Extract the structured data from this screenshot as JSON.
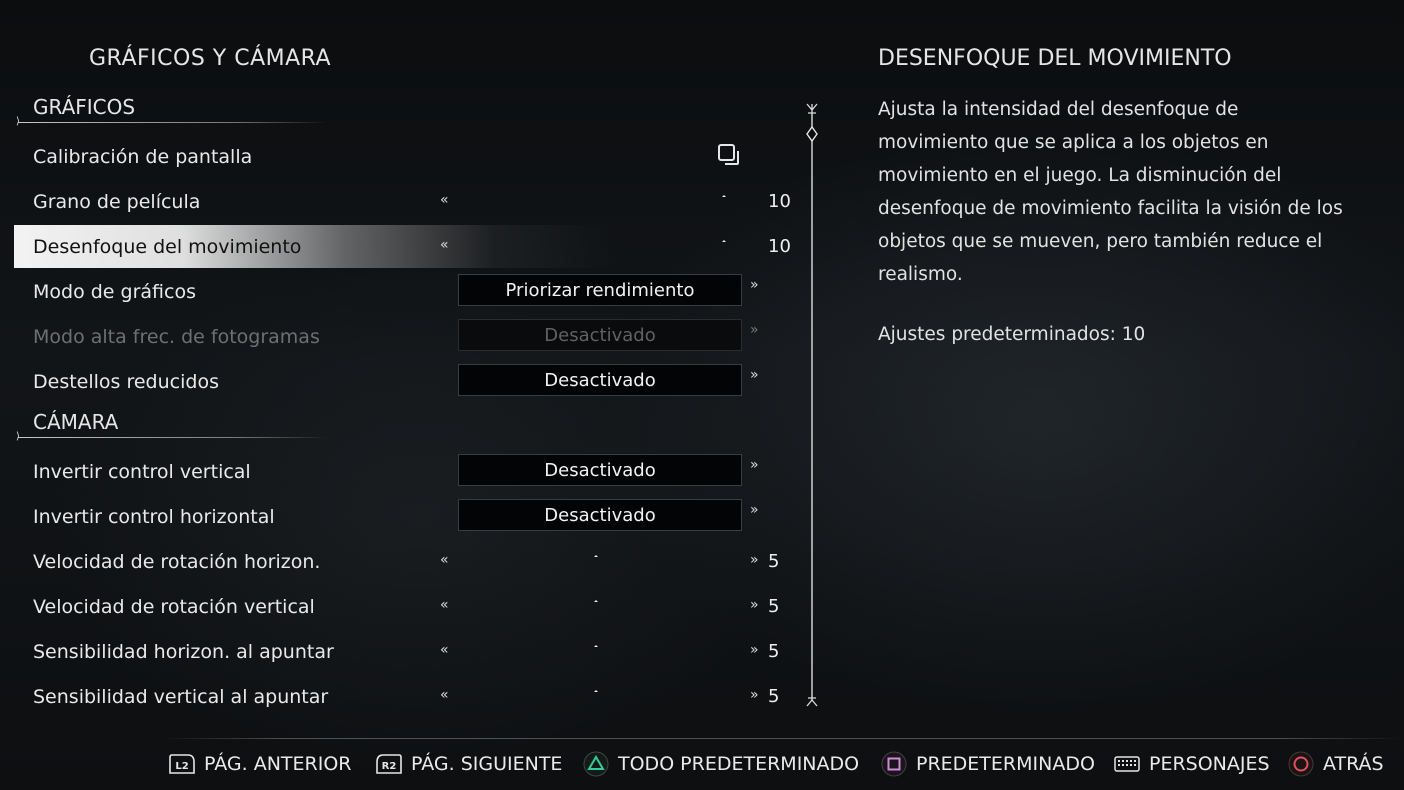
{
  "page_title": "GRÁFICOS Y CÁMARA",
  "sections": {
    "graphics": "GRÁFICOS",
    "camera": "CÁMARA"
  },
  "rows": [
    {
      "label": "Calibración de pantalla"
    },
    {
      "label": "Grano de película",
      "value": "10",
      "level": 1.0
    },
    {
      "label": "Desenfoque del movimiento",
      "value": "10",
      "level": 1.0
    },
    {
      "label": "Modo de gráficos",
      "option": "Priorizar rendimiento"
    },
    {
      "label": "Modo alta frec. de fotogramas",
      "option": "Desactivado"
    },
    {
      "label": "Destellos reducidos",
      "option": "Desactivado"
    },
    {
      "label": "Invertir control vertical",
      "option": "Desactivado"
    },
    {
      "label": "Invertir control horizontal",
      "option": "Desactivado"
    },
    {
      "label": "Velocidad de rotación horizon.",
      "value": "5",
      "level": 0.5
    },
    {
      "label": "Velocidad de rotación vertical",
      "value": "5",
      "level": 0.5
    },
    {
      "label": "Sensibilidad horizon. al apuntar",
      "value": "5",
      "level": 0.5
    },
    {
      "label": "Sensibilidad vertical al apuntar",
      "value": "5",
      "level": 0.5
    }
  ],
  "selected_row": "Desenfoque del movimiento",
  "disabled_row": "Modo alta frec. de fotogramas",
  "slider_glyphs": {
    "left": "«",
    "right": "»"
  },
  "detail": {
    "title": "DESENFOQUE DEL MOVIMIENTO",
    "description": "Ajusta la intensidad del desenfoque de movimiento que se aplica a los objetos en movimiento en el juego. La disminución del desenfoque de movimiento facilita la visión de los objetos que se mueven, pero también reduce el realismo.",
    "default_text": "Ajustes predeterminados: 10"
  },
  "footer": {
    "prev_button": "L2",
    "prev_label": "PÁG. ANTERIOR",
    "next_button": "R2",
    "next_label": "PÁG. SIGUIENTE",
    "all_default_label": "TODO PREDETERMINADO",
    "default_label": "PREDETERMINADO",
    "characters_label": "PERSONAJES",
    "back_label": "ATRÁS"
  },
  "colors": {
    "triangle": "#2ecf9a",
    "square": "#d28ad8",
    "circle": "#e0505e"
  },
  "icons": [
    "calibration-icon",
    "triangle-button-icon",
    "square-button-icon",
    "touchpad-icon",
    "circle-button-icon"
  ]
}
